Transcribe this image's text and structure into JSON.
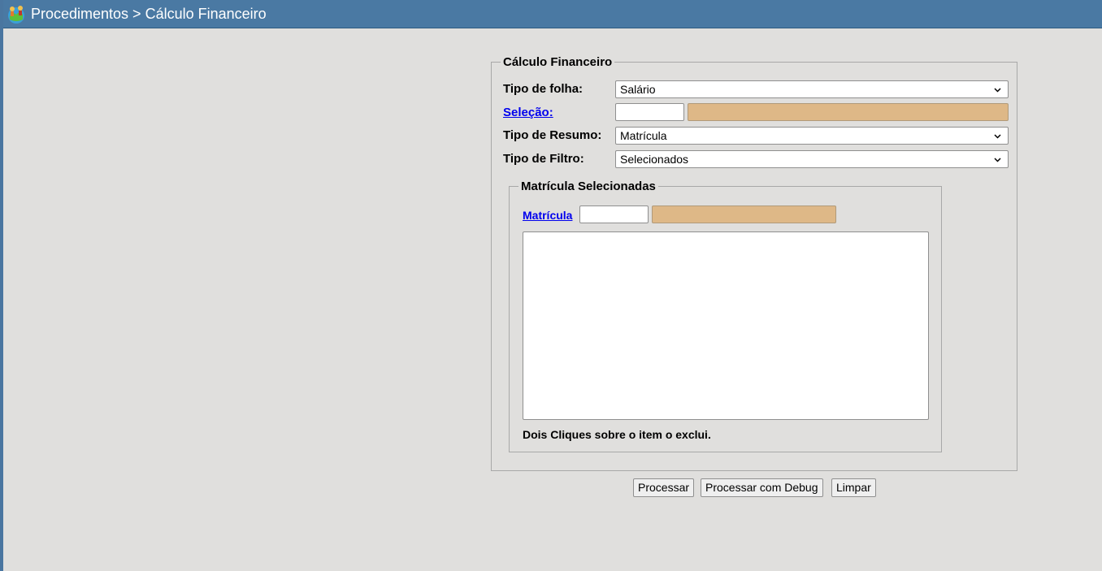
{
  "header": {
    "logo_icon": "people-globe-icon",
    "title": "Procedimentos > Cálculo Financeiro"
  },
  "form": {
    "legend": "Cálculo Financeiro",
    "tipo_folha": {
      "label": "Tipo de folha:",
      "value": "Salário"
    },
    "selecao": {
      "label": "Seleção:",
      "code_value": "",
      "description_value": ""
    },
    "tipo_resumo": {
      "label": "Tipo de Resumo:",
      "value": "Matrícula"
    },
    "tipo_filtro": {
      "label": "Tipo de Filtro:",
      "value": "Selecionados"
    },
    "selected": {
      "legend": "Matrícula Selecionadas",
      "matricula_label": "Matrícula",
      "matricula_value": "",
      "matricula_description": "",
      "items": [],
      "hint": "Dois Cliques sobre o item o exclui."
    }
  },
  "buttons": {
    "processar": "Processar",
    "processar_debug": "Processar com Debug",
    "limpar": "Limpar"
  },
  "colors": {
    "header": "#4a79a3",
    "readonly_field": "#deb887",
    "background": "#e0dfdd",
    "link": "#0000ee"
  }
}
